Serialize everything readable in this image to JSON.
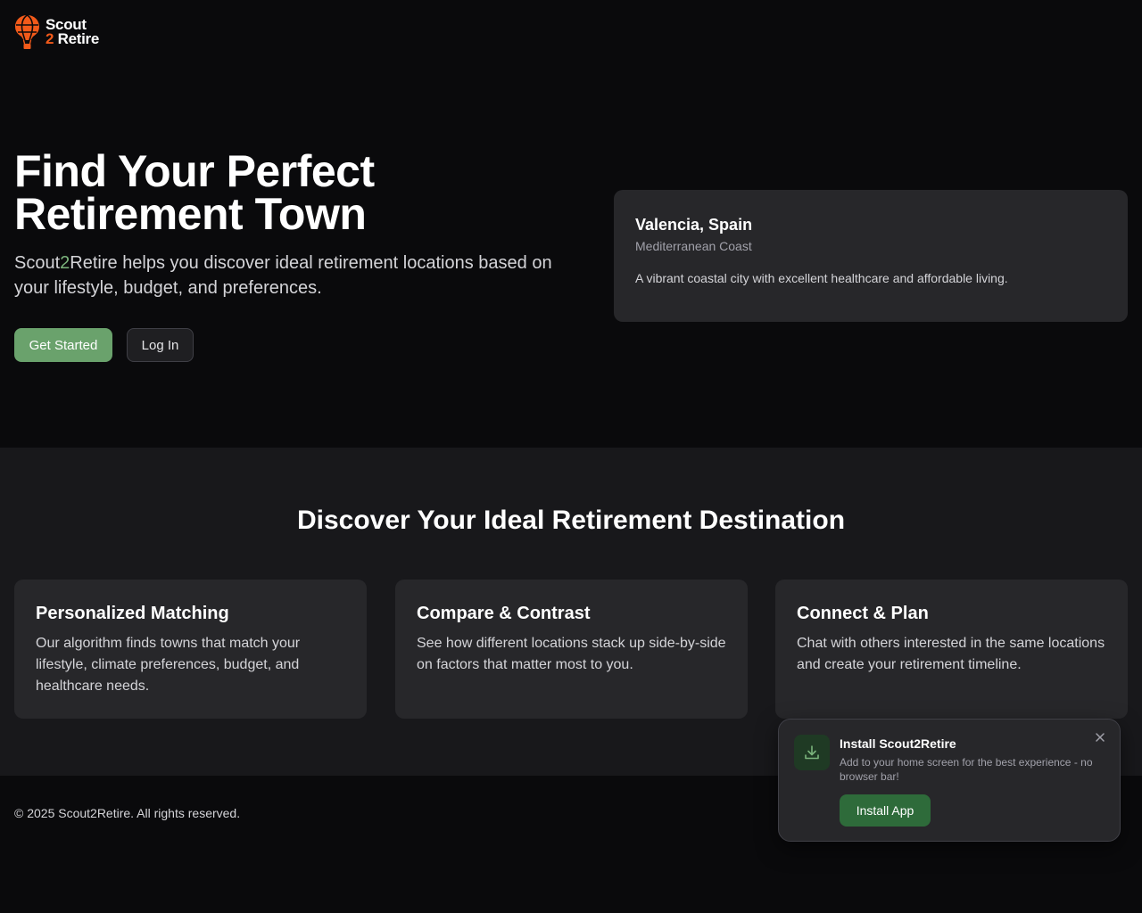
{
  "brand": {
    "line1": "Scout",
    "number": "2",
    "word": "Retire",
    "logo_icon": "hot-air-balloon-icon",
    "accent_color": "#f25a1a"
  },
  "hero": {
    "title": "Find Your Perfect Retirement Town",
    "subtitle_pre": "Scout",
    "subtitle_accent": "2",
    "subtitle_post": "Retire helps you discover ideal retirement locations based on your lifestyle, budget, and preferences.",
    "primary_button": "Get Started",
    "secondary_button": "Log In",
    "primary_color": "#6aa26c"
  },
  "featured_town": {
    "name": "Valencia, Spain",
    "region": "Mediterranean Coast",
    "description": "A vibrant coastal city with excellent healthcare and affordable living."
  },
  "features": {
    "title": "Discover Your Ideal Retirement Destination",
    "cards": [
      {
        "title": "Personalized Matching",
        "description": "Our algorithm finds towns that match your lifestyle, climate preferences, budget, and healthcare needs."
      },
      {
        "title": "Compare & Contrast",
        "description": "See how different locations stack up side-by-side on factors that matter most to you."
      },
      {
        "title": "Connect & Plan",
        "description": "Chat with others interested in the same locations and create your retirement timeline."
      }
    ]
  },
  "footer": {
    "copyright": "© 2025 Scout2Retire. All rights reserved."
  },
  "install_prompt": {
    "title": "Install Scout2Retire",
    "description": "Add to your home screen for the best experience - no browser bar!",
    "button": "Install App",
    "icon": "download-icon",
    "close_icon": "close-icon",
    "button_color": "#2e6b3a"
  }
}
